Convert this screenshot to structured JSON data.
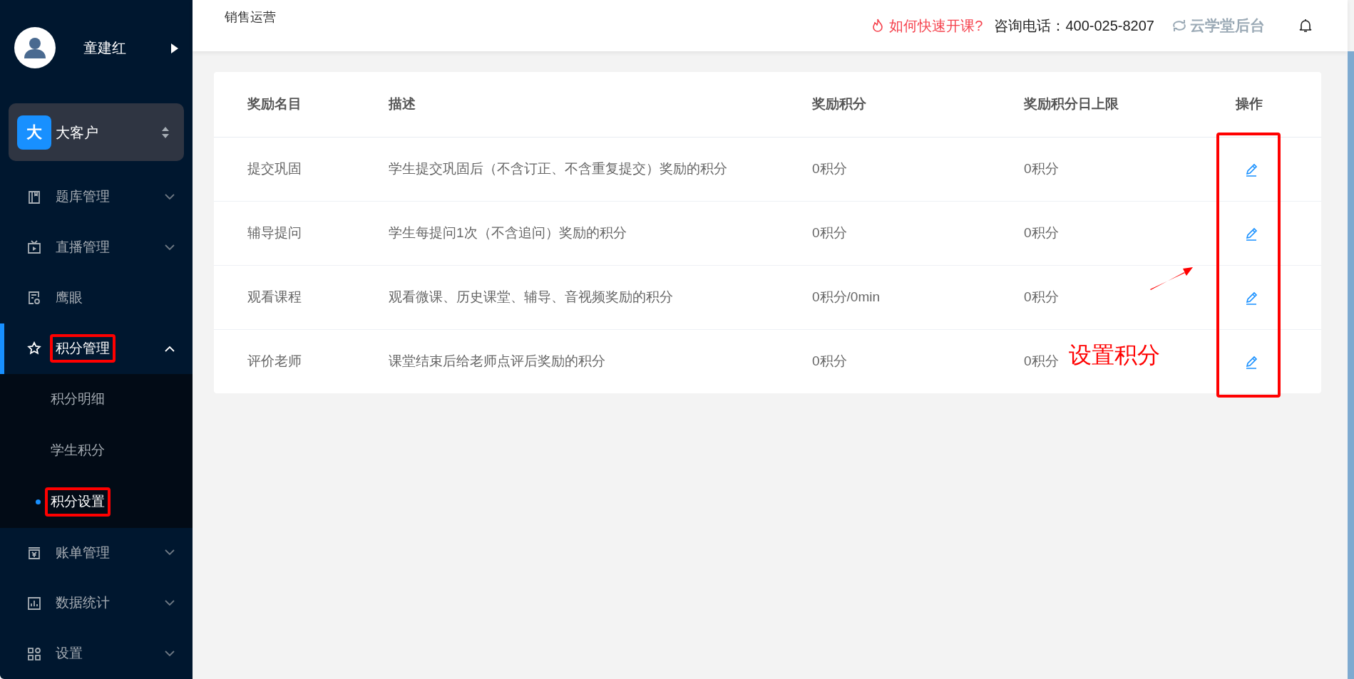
{
  "user": {
    "name": "童建红"
  },
  "tenant": {
    "badge": "大",
    "name": "大客户"
  },
  "menu": [
    {
      "label": "题库管理",
      "expanded": false,
      "selected": false,
      "highlighted": false
    },
    {
      "label": "直播管理",
      "expanded": false,
      "selected": false,
      "highlighted": false
    },
    {
      "label": "鹰眼",
      "selected": false,
      "highlighted": false
    },
    {
      "label": "积分管理",
      "expanded": true,
      "selected": true,
      "highlighted": true,
      "children": [
        {
          "label": "积分明细",
          "selected": false,
          "highlighted": false
        },
        {
          "label": "学生积分",
          "selected": false,
          "highlighted": false
        },
        {
          "label": "积分设置",
          "selected": true,
          "highlighted": true
        }
      ]
    },
    {
      "label": "账单管理",
      "expanded": false,
      "selected": false,
      "highlighted": false
    },
    {
      "label": "数据统计",
      "expanded": false,
      "selected": false,
      "highlighted": false
    },
    {
      "label": "设置",
      "expanded": false,
      "selected": false,
      "highlighted": false
    }
  ],
  "header": {
    "breadcrumb": "销售运营",
    "help_link": "如何快速开课?",
    "phone": "咨询电话：400-025-8207",
    "switch_label": "云学堂后台"
  },
  "table": {
    "columns": [
      "奖励名目",
      "描述",
      "奖励积分",
      "奖励积分日上限",
      "操作"
    ],
    "rows": [
      {
        "name": "提交巩固",
        "description": "学生提交巩固后（不含订正、不含重复提交）奖励的积分",
        "points": "0积分",
        "daily_limit": "0积分"
      },
      {
        "name": "辅导提问",
        "description": "学生每提问1次（不含追问）奖励的积分",
        "points": "0积分",
        "daily_limit": "0积分"
      },
      {
        "name": "观看课程",
        "description": "观看微课、历史课堂、辅导、音视频奖励的积分",
        "points": "0积分/0min",
        "daily_limit": "0积分"
      },
      {
        "name": "评价老师",
        "description": "课堂结束后给老师点评后奖励的积分",
        "points": "0积分",
        "daily_limit": "0积分"
      }
    ],
    "action_column_highlighted": true
  },
  "annotation": {
    "text": "设置积分"
  }
}
